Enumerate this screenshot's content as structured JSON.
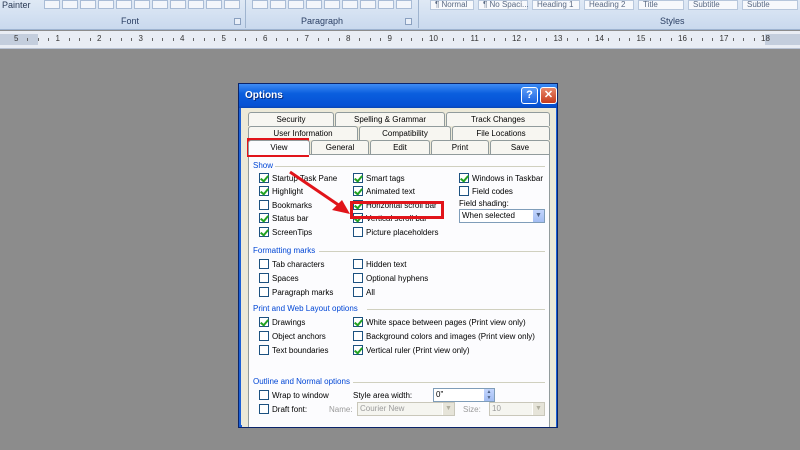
{
  "ribbon": {
    "painter_label": "Painter",
    "font_group": "Font",
    "paragraph_group": "Paragraph",
    "styles_group": "Styles",
    "style_gallery": [
      "¶ Normal",
      "¶ No Spaci...",
      "Heading 1",
      "Heading 2",
      "Title",
      "Subtitle",
      "Subtle"
    ]
  },
  "ruler": {
    "numbers": [
      "5",
      "1",
      "2",
      "3",
      "4",
      "5",
      "6",
      "7",
      "8",
      "9",
      "10",
      "11",
      "12",
      "13",
      "14",
      "15",
      "16",
      "17",
      "18"
    ]
  },
  "dialog": {
    "title": "Options",
    "help_glyph": "?",
    "close_glyph": "✕",
    "tabs_row1": [
      "Security",
      "Spelling & Grammar",
      "Track Changes"
    ],
    "tabs_row2": [
      "User Information",
      "Compatibility",
      "File Locations"
    ],
    "tabs_row3": [
      "View",
      "General",
      "Edit",
      "Print",
      "Save"
    ],
    "active_tab": "View",
    "show": {
      "heading": "Show",
      "col1": [
        {
          "label": "Startup Task Pane",
          "checked": true
        },
        {
          "label": "Highlight",
          "checked": true
        },
        {
          "label": "Bookmarks",
          "checked": false
        },
        {
          "label": "Status bar",
          "checked": true
        },
        {
          "label": "ScreenTips",
          "checked": true
        }
      ],
      "col2": [
        {
          "label": "Smart tags",
          "checked": true
        },
        {
          "label": "Animated text",
          "checked": true
        },
        {
          "label": "Horizontal scroll bar",
          "checked": true
        },
        {
          "label": "Vertical scroll bar",
          "checked": true
        },
        {
          "label": "Picture placeholders",
          "checked": false
        }
      ],
      "col3": [
        {
          "label": "Windows in Taskbar",
          "checked": true
        },
        {
          "label": "Field codes",
          "checked": false
        }
      ],
      "field_shading_label": "Field shading:",
      "field_shading_value": "When selected"
    },
    "formatting": {
      "heading": "Formatting marks",
      "col1": [
        {
          "label": "Tab characters",
          "checked": false
        },
        {
          "label": "Spaces",
          "checked": false
        },
        {
          "label": "Paragraph marks",
          "checked": false
        }
      ],
      "col2": [
        {
          "label": "Hidden text",
          "checked": false
        },
        {
          "label": "Optional hyphens",
          "checked": false
        },
        {
          "label": "All",
          "checked": false
        }
      ]
    },
    "print_web": {
      "heading": "Print and Web Layout options",
      "col1": [
        {
          "label": "Drawings",
          "checked": true
        },
        {
          "label": "Object anchors",
          "checked": false
        },
        {
          "label": "Text boundaries",
          "checked": false
        }
      ],
      "col2": [
        {
          "label": "White space between pages (Print view only)",
          "checked": true
        },
        {
          "label": "Background colors and images (Print view only)",
          "checked": false
        },
        {
          "label": "Vertical ruler (Print view only)",
          "checked": true
        }
      ]
    },
    "outline": {
      "heading": "Outline and Normal options",
      "wrap": {
        "label": "Wrap to window",
        "checked": false
      },
      "draft": {
        "label": "Draft font:",
        "checked": false
      },
      "style_area_label": "Style area width:",
      "style_area_value": "0\"",
      "name_label": "Name:",
      "name_value": "Courier New",
      "size_label": "Size:",
      "size_value": "10"
    }
  },
  "colors": {
    "highlight": "#e1141a",
    "section_heading": "#0046d5",
    "title_bar": "#0a5ede"
  }
}
